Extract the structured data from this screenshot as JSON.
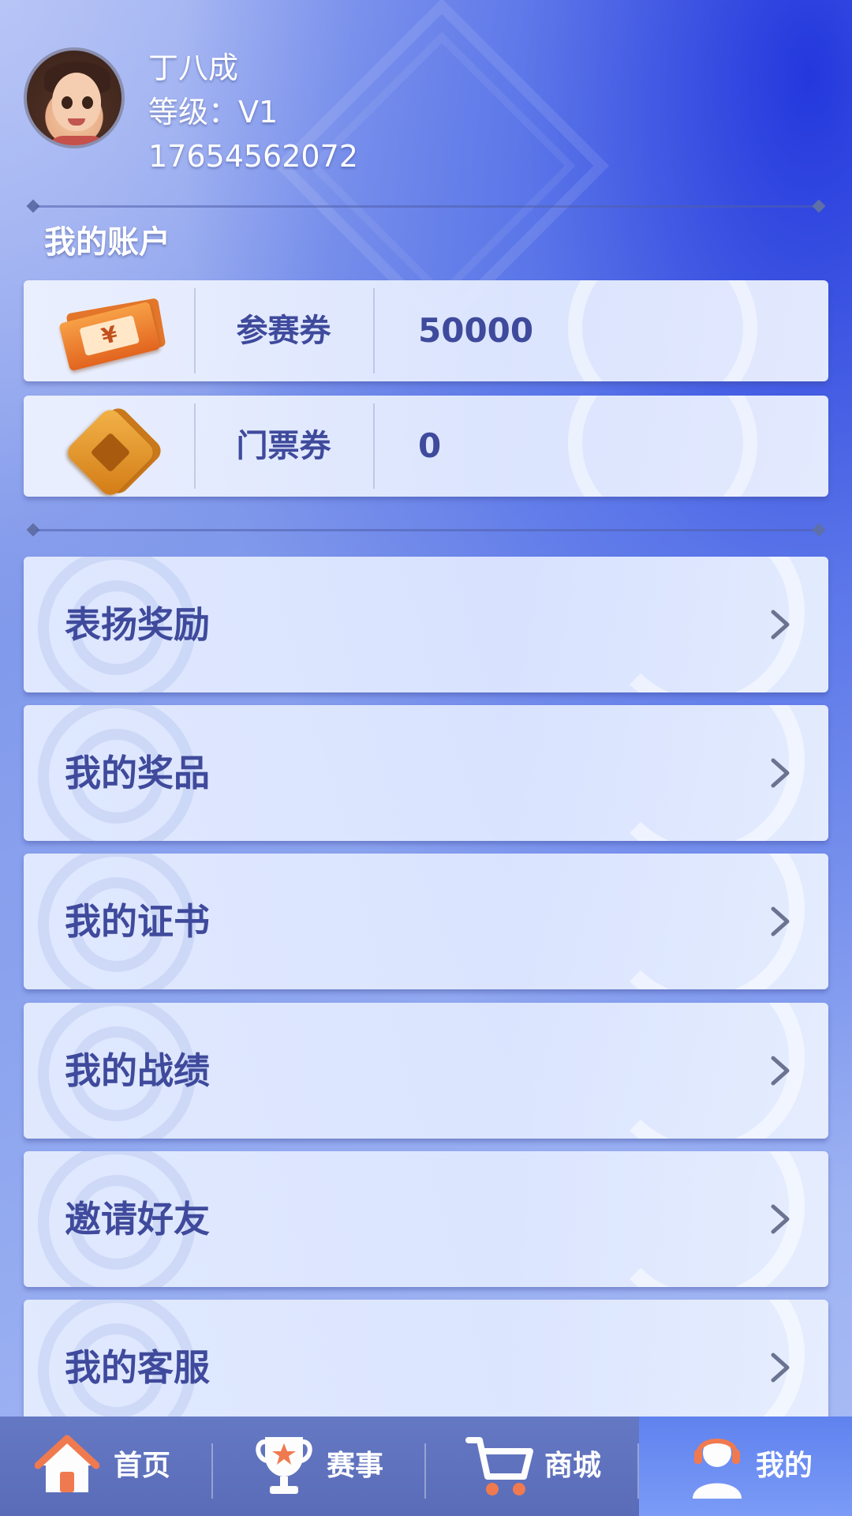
{
  "profile": {
    "name": "丁八成",
    "level": "等级：V1",
    "phone": "17654562072"
  },
  "account": {
    "title": "我的账户",
    "rows": [
      {
        "icon": "ticket-icon",
        "label": "参赛券",
        "value": "50000"
      },
      {
        "icon": "gold-coin-icon",
        "label": "门票券",
        "value": "0"
      }
    ]
  },
  "menu": [
    {
      "label": "表扬奖励"
    },
    {
      "label": "我的奖品"
    },
    {
      "label": "我的证书"
    },
    {
      "label": "我的战绩"
    },
    {
      "label": "邀请好友"
    },
    {
      "label": "我的客服"
    }
  ],
  "nav": [
    {
      "label": "首页",
      "icon": "home-icon",
      "active": false
    },
    {
      "label": "赛事",
      "icon": "trophy-icon",
      "active": false
    },
    {
      "label": "商城",
      "icon": "cart-icon",
      "active": false
    },
    {
      "label": "我的",
      "icon": "user-headset-icon",
      "active": true
    }
  ],
  "colors": {
    "accent_text": "#3f4a9c",
    "nav_bg": "#5f70bb",
    "nav_active": "#6b8cf2",
    "icon_orange": "#f07a4f"
  }
}
